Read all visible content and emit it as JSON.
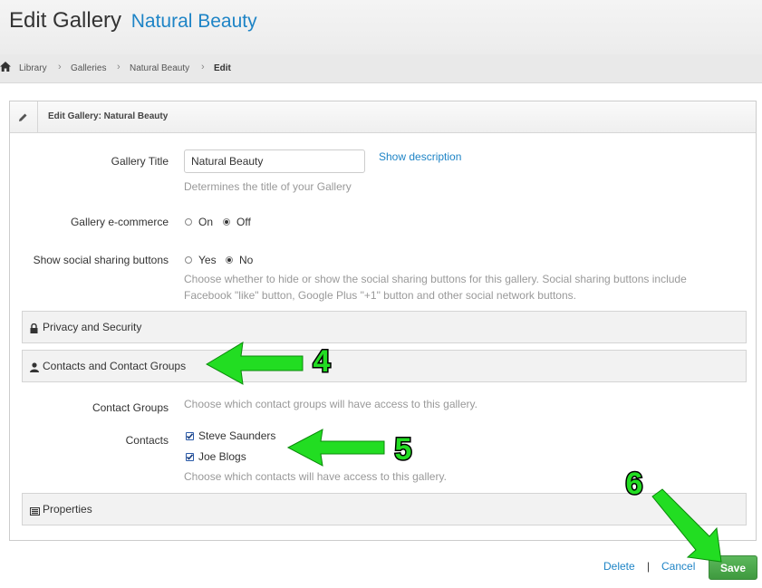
{
  "header": {
    "title": "Edit Gallery",
    "subtitle": "Natural Beauty"
  },
  "breadcrumb": {
    "items": [
      "Library",
      "Galleries",
      "Natural Beauty",
      "Edit"
    ]
  },
  "panel": {
    "title": "Edit Gallery: Natural Beauty"
  },
  "form": {
    "gallery_title_label": "Gallery Title",
    "gallery_title_value": "Natural Beauty",
    "show_description_link": "Show description",
    "gallery_title_help": "Determines the title of your Gallery",
    "ecommerce_label": "Gallery e-commerce",
    "ecommerce_on": "On",
    "ecommerce_off": "Off",
    "ecommerce_selected": "Off",
    "social_label": "Show social sharing buttons",
    "social_yes": "Yes",
    "social_no": "No",
    "social_selected": "No",
    "social_help_1": "Choose whether to hide or show the social sharing buttons for this gallery. Social sharing buttons include",
    "social_help_2": "Facebook \"like\" button, Google Plus \"+1\" button and other social network buttons.",
    "contact_groups_label": "Contact Groups",
    "contact_groups_help": "Choose which contact groups will have access to this gallery.",
    "contacts_label": "Contacts",
    "contacts": [
      {
        "name": "Steve Saunders",
        "checked": true
      },
      {
        "name": "Joe Blogs",
        "checked": true
      }
    ],
    "contacts_help": "Choose which contacts will have access to this gallery."
  },
  "sections": {
    "privacy": "Privacy and Security",
    "contacts": "Contacts and Contact Groups",
    "properties": "Properties"
  },
  "actions": {
    "delete": "Delete",
    "separator": "|",
    "cancel": "Cancel",
    "save": "Save"
  },
  "annotations": {
    "arrow_4": "4",
    "arrow_5": "5",
    "arrow_6": "6"
  },
  "colors": {
    "link": "#1e84c6",
    "save": "#4cae4c",
    "annotation_arrow": "#22dd22"
  }
}
